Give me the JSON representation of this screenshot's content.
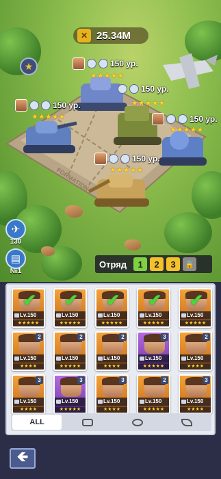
{
  "header": {
    "power_value": "25.34M",
    "power_icon": "crossed-swords-icon"
  },
  "formation_label": "FORMATION",
  "units": [
    {
      "id": "top",
      "level": "150 ур.",
      "stars": "★★★★★"
    },
    {
      "id": "right-mid",
      "level": "150 ур.",
      "stars": "★★★★★"
    },
    {
      "id": "left",
      "level": "150 ур.",
      "stars": "★★★★★"
    },
    {
      "id": "far-right",
      "level": "150 ур.",
      "stars": "★★★★★"
    },
    {
      "id": "bottom",
      "level": "150 ур.",
      "stars": "★★★★★"
    }
  ],
  "side": {
    "airplane_count": "130",
    "rank_label": "№1"
  },
  "squad": {
    "label": "Отряд",
    "slots": [
      "1",
      "2",
      "3"
    ],
    "lock_icon": "lock-icon"
  },
  "roster": [
    {
      "lvl": "Lv.150",
      "stars": "★★★★★",
      "badge": "",
      "selected": true,
      "color": "orange"
    },
    {
      "lvl": "Lv.150",
      "stars": "★★★★★",
      "badge": "",
      "selected": true,
      "color": "orange"
    },
    {
      "lvl": "Lv.150",
      "stars": "★★★★★",
      "badge": "",
      "selected": true,
      "color": "orange"
    },
    {
      "lvl": "Lv.150",
      "stars": "★★★★★",
      "badge": "",
      "selected": true,
      "color": "orange"
    },
    {
      "lvl": "Lv.150",
      "stars": "★★★★★",
      "badge": "",
      "selected": true,
      "color": "orange"
    },
    {
      "lvl": "Lv.150",
      "stars": "★★★★",
      "badge": "2",
      "selected": false,
      "color": "orange"
    },
    {
      "lvl": "Lv.150",
      "stars": "★★★★★",
      "badge": "2",
      "selected": false,
      "color": "orange"
    },
    {
      "lvl": "Lv.150",
      "stars": "★★★★",
      "badge": "2",
      "selected": false,
      "color": "orange"
    },
    {
      "lvl": "Lv.150",
      "stars": "★★★★★",
      "badge": "3",
      "selected": false,
      "color": "purple"
    },
    {
      "lvl": "Lv.150",
      "stars": "★★★★",
      "badge": "2",
      "selected": false,
      "color": "orange"
    },
    {
      "lvl": "Lv.150",
      "stars": "★★★★",
      "badge": "3",
      "selected": false,
      "color": "orange"
    },
    {
      "lvl": "Lv.150",
      "stars": "★★★★★",
      "badge": "3",
      "selected": false,
      "color": "purple"
    },
    {
      "lvl": "Lv.150",
      "stars": "★★★★",
      "badge": "3",
      "selected": false,
      "color": "orange"
    },
    {
      "lvl": "Lv.150",
      "stars": "★★★★★",
      "badge": "2",
      "selected": false,
      "color": "orange"
    },
    {
      "lvl": "Lv.150",
      "stars": "★★★★",
      "badge": "3",
      "selected": false,
      "color": "orange"
    }
  ],
  "filters": [
    {
      "label": "ALL",
      "icon": ""
    },
    {
      "label": "",
      "icon": "tank-icon"
    },
    {
      "label": "",
      "icon": "artillery-icon"
    },
    {
      "label": "",
      "icon": "aircraft-icon"
    }
  ],
  "back_icon": "back-arrow-icon"
}
